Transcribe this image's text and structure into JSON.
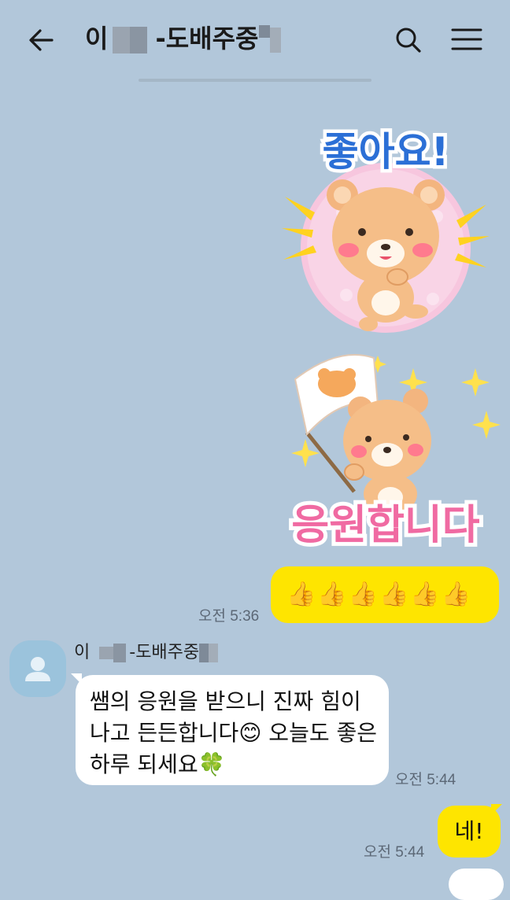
{
  "header": {
    "title_prefix": "이",
    "title_middle": "-도배주중",
    "back_icon": "arrow-left-icon",
    "search_icon": "search-icon",
    "menu_icon": "hamburger-menu-icon"
  },
  "messages": {
    "sticker1_text": "좋아요!",
    "sticker2_text": "응원합니다",
    "thumbs": "👍👍👍👍👍👍",
    "time1": "오전 5:36",
    "sender_prefix": "이",
    "sender_middle": "-도배주중",
    "other_text": "쌤의 응원을 받으니 진짜 힘이 나고 든든합니다😊 오늘도 좋은 하루 되세요🍀",
    "time2": "오전 5:44",
    "reply_text": "네!",
    "time3": "오전 5:44"
  },
  "colors": {
    "background": "#b2c7da",
    "my_bubble": "#fee500",
    "other_bubble": "#ffffff",
    "sticker_pink": "#f06aa2",
    "sticker_blue": "#2b6fd6"
  }
}
